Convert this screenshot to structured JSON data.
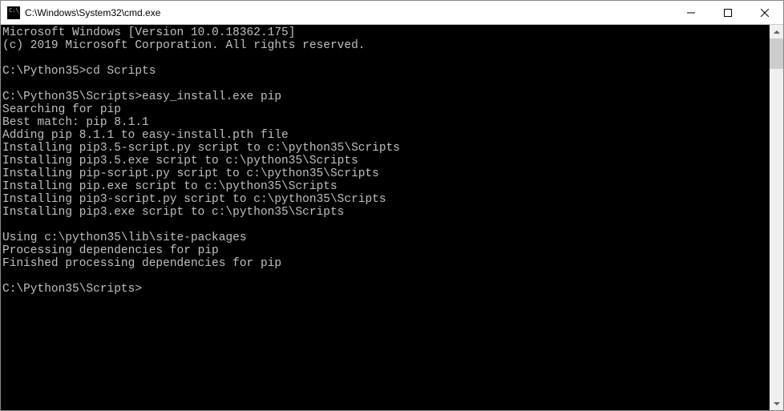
{
  "window": {
    "title": "C:\\Windows\\System32\\cmd.exe"
  },
  "terminal": {
    "lines": [
      "Microsoft Windows [Version 10.0.18362.175]",
      "(c) 2019 Microsoft Corporation. All rights reserved.",
      "",
      "C:\\Python35>cd Scripts",
      "",
      "C:\\Python35\\Scripts>easy_install.exe pip",
      "Searching for pip",
      "Best match: pip 8.1.1",
      "Adding pip 8.1.1 to easy-install.pth file",
      "Installing pip3.5-script.py script to c:\\python35\\Scripts",
      "Installing pip3.5.exe script to c:\\python35\\Scripts",
      "Installing pip-script.py script to c:\\python35\\Scripts",
      "Installing pip.exe script to c:\\python35\\Scripts",
      "Installing pip3-script.py script to c:\\python35\\Scripts",
      "Installing pip3.exe script to c:\\python35\\Scripts",
      "",
      "Using c:\\python35\\lib\\site-packages",
      "Processing dependencies for pip",
      "Finished processing dependencies for pip",
      ""
    ],
    "current_prompt": "C:\\Python35\\Scripts>"
  }
}
